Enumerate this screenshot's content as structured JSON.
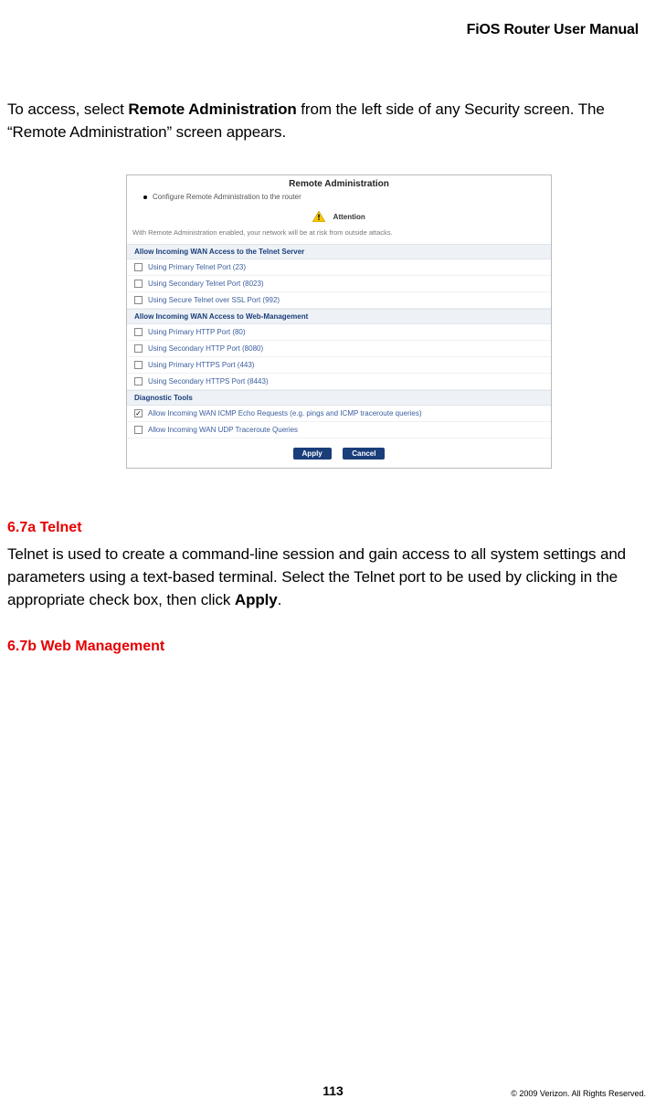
{
  "header": {
    "title": "FiOS Router User Manual"
  },
  "intro": {
    "pre": "To access, select ",
    "bold": "Remote Administration",
    "post": " from the left side of any Security screen. The “Remote Administration” screen appears."
  },
  "screenshot": {
    "title": "Remote Administration",
    "subtitle": "Configure Remote Administration to the router",
    "attention_label": "Attention",
    "attention_text": "With Remote Administration enabled, your network will be at risk from outside attacks.",
    "sections": [
      {
        "header": "Allow Incoming WAN Access to the Telnet Server",
        "rows": [
          {
            "label": "Using Primary Telnet Port (23)",
            "checked": false
          },
          {
            "label": "Using Secondary Telnet Port (8023)",
            "checked": false
          },
          {
            "label": "Using Secure Telnet over SSL Port (992)",
            "checked": false
          }
        ]
      },
      {
        "header": "Allow Incoming WAN Access to Web-Management",
        "rows": [
          {
            "label": "Using Primary HTTP Port (80)",
            "checked": false
          },
          {
            "label": "Using Secondary HTTP Port (8080)",
            "checked": false
          },
          {
            "label": "Using Primary HTTPS Port (443)",
            "checked": false
          },
          {
            "label": "Using Secondary HTTPS Port (8443)",
            "checked": false
          }
        ]
      },
      {
        "header": "Diagnostic Tools",
        "rows": [
          {
            "label": "Allow Incoming WAN ICMP Echo Requests (e.g. pings and ICMP traceroute queries)",
            "checked": true
          },
          {
            "label": "Allow Incoming WAN UDP Traceroute Queries",
            "checked": false
          }
        ]
      }
    ],
    "buttons": {
      "apply": "Apply",
      "cancel": "Cancel"
    }
  },
  "sec_67a": {
    "heading": "6.7a  Telnet",
    "text_pre": "Telnet is used to create a command-line session and gain access to all system settings and parameters using a text-based terminal. Select the Telnet port to be used by clicking in the appropriate check box, then click ",
    "text_bold": "Apply",
    "text_post": "."
  },
  "sec_67b": {
    "heading": "6.7b  Web Management"
  },
  "footer": {
    "page": "113",
    "copyright": "© 2009 Verizon. All Rights Reserved."
  }
}
